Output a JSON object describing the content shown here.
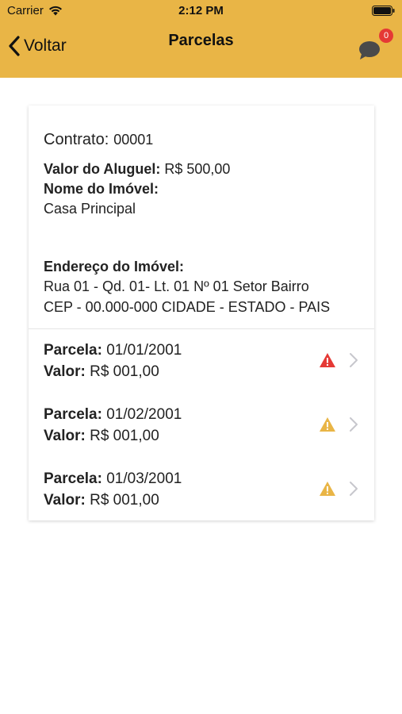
{
  "status_bar": {
    "carrier": "Carrier",
    "time": "2:12 PM"
  },
  "nav": {
    "back_label": "Voltar",
    "title": "Parcelas",
    "notification_count": "0"
  },
  "contract": {
    "label": "Contrato:",
    "number": "00001",
    "rent_label": "Valor do Aluguel:",
    "rent_value": "R$ 500,00",
    "property_name_label": "Nome do Imóvel:",
    "property_name": "Casa Principal",
    "address_label": "Endereço do Imóvel:",
    "address_line1": "Rua 01 - Qd. 01- Lt. 01 Nº 01 Setor Bairro",
    "address_line2": "CEP - 00.000-000 CIDADE - ESTADO - PAIS"
  },
  "installments": [
    {
      "date_label": "Parcela:",
      "date": "01/01/2001",
      "value_label": "Valor:",
      "value": "R$ 001,00",
      "status_color": "#E53935"
    },
    {
      "date_label": "Parcela:",
      "date": "01/02/2001",
      "value_label": "Valor:",
      "value": "R$ 001,00",
      "status_color": "#E9B546"
    },
    {
      "date_label": "Parcela:",
      "date": "01/03/2001",
      "value_label": "Valor:",
      "value": "R$ 001,00",
      "status_color": "#E9B546"
    }
  ],
  "colors": {
    "header": "#E9B546",
    "badge": "#E53935",
    "chevron": "#c7c7cc"
  },
  "icons": {
    "wifi": "wifi-icon",
    "battery": "battery-icon",
    "back": "chevron-left-icon",
    "chat": "chat-bubble-icon",
    "warning": "warning-triangle-icon",
    "chevron": "chevron-right-icon"
  }
}
